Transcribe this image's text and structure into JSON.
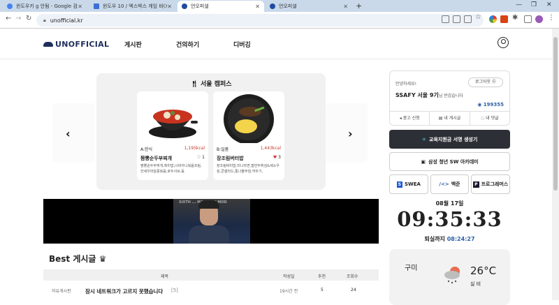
{
  "browser": {
    "tabs": [
      {
        "label": "윈도우키 g 안됨 - Google 검색",
        "color": "#4285f4"
      },
      {
        "label": "윈도우 10 / 엑스박스 게임 바(X",
        "color": "#3b6fd4"
      },
      {
        "label": "언오피셜",
        "color": "#1f4aa0"
      },
      {
        "label": "언오피셜",
        "color": "#1f4aa0"
      }
    ],
    "url": "unofficial.kr"
  },
  "header": {
    "logo": "UNOFFICIAL",
    "menu": [
      "게시판",
      "건의하기",
      "디버깅"
    ]
  },
  "carousel": {
    "title": "서울 캠퍼스",
    "cards": [
      {
        "course": "A:한식",
        "kcal": "1,195kcal",
        "name": "짬뽕순두부찌개",
        "likes": "1",
        "desc": "짬뽕순두부찌개,흑미밥,너비아니볶음조림,잔새우마늘쫑볶음,호두샤브,동"
      },
      {
        "course": "B:일품",
        "kcal": "1,443kcal",
        "name": "장조림버터밥",
        "likes": "3",
        "desc": "장조림버터밥,미니라면,팝만두튀김&새소우킹,콘샐러드,통나물무침,깍두기,"
      }
    ]
  },
  "video": {
    "caption": "SIXTH ... MARKETH MOD"
  },
  "best": {
    "title": "Best 게시글",
    "columns": [
      "제목",
      "작성일",
      "추천",
      "조회수"
    ],
    "rows": [
      {
        "board": "자유게시판",
        "title": "잠시 네트워크가 고르지 못했습니다",
        "comments": "[5]",
        "date": "19시간 전",
        "likes": "5",
        "views": "24"
      }
    ]
  },
  "profile": {
    "greeting": "안녕하세요!",
    "logout": "로그아웃",
    "name": "SSAFY 서울 9기",
    "suffix": "님 반갑습니다",
    "points": "199355",
    "actions": [
      "광고 신청",
      "내 게시글",
      "내 댓글"
    ]
  },
  "buttons": {
    "sign": "교육지원금 서명 생성기",
    "academy": "삼성 청년 SW 아카데미",
    "links": [
      "SWEA",
      "백준",
      "프로그래머스"
    ]
  },
  "clock": {
    "date": "08월 17일",
    "time": "09:35:33",
    "remain_label": "퇴실까지",
    "remain": "08:24:27"
  },
  "weather": {
    "city": "구미",
    "temp": "26°C",
    "condition": "실 비"
  }
}
